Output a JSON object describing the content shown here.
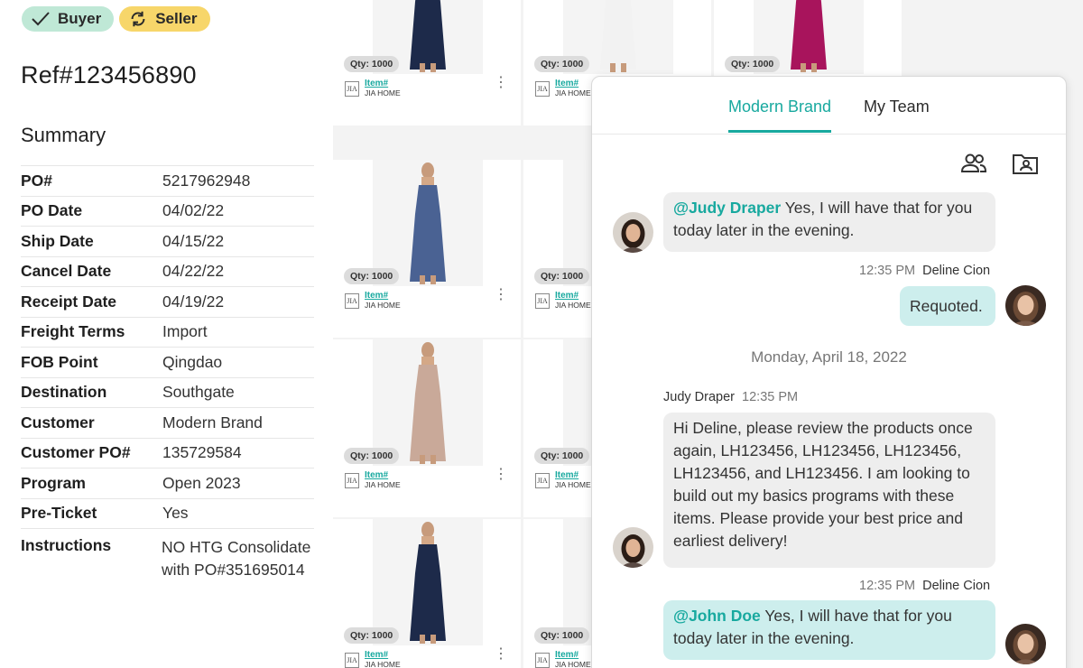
{
  "roles": {
    "buyer": "Buyer",
    "seller": "Seller"
  },
  "ref": "Ref#123456890",
  "summary": {
    "title": "Summary",
    "rows": [
      {
        "key": "PO#",
        "value": "5217962948"
      },
      {
        "key": "PO Date",
        "value": "04/02/22"
      },
      {
        "key": "Ship Date",
        "value": "04/15/22"
      },
      {
        "key": "Cancel Date",
        "value": "04/22/22"
      },
      {
        "key": "Receipt Date",
        "value": "04/19/22"
      },
      {
        "key": "Freight Terms",
        "value": "Import"
      },
      {
        "key": "FOB Point",
        "value": "Qingdao"
      },
      {
        "key": "Destination",
        "value": "Southgate"
      },
      {
        "key": "Customer",
        "value": "Modern Brand"
      },
      {
        "key": "Customer PO#",
        "value": "135729584"
      },
      {
        "key": "Program",
        "value": "Open 2023"
      },
      {
        "key": "Pre-Ticket",
        "value": "Yes"
      },
      {
        "key": "Instructions",
        "value": "NO HTG Consolidate with PO#351695014"
      }
    ]
  },
  "products": {
    "qty_label": "Qty: 1000",
    "item_label": "Item#",
    "brand_name": "JIA HOME",
    "brand_logo": "JIA",
    "tiles": [
      {
        "dress_color": "#1d2a4a"
      },
      {
        "dress_color": "#f2f2f2"
      },
      {
        "dress_color": "#a8145c"
      },
      {
        "dress_color": "#4a6293"
      },
      {
        "dress_color": "#3e3e3e"
      },
      {
        "dress_color": "#2f6b5a"
      },
      {
        "dress_color": "#c9a999"
      },
      {
        "dress_color": "#1d2a4a"
      },
      {
        "dress_color": "#dddddd"
      }
    ]
  },
  "chat": {
    "tabs": [
      "Modern Brand",
      "My Team"
    ],
    "icons": [
      "people-icon",
      "folder-contact-icon"
    ],
    "messages": {
      "m1_mention": "@Judy Draper",
      "m1_text": " Yes, I will have that for you today later in the evening.",
      "m2_time": "12:35 PM",
      "m2_author": "Deline Cion",
      "m2_text": "Requoted.",
      "date": "Monday, April 18, 2022",
      "m3_author": "Judy Draper",
      "m3_time": "12:35 PM",
      "m3_text": "Hi Deline, please review the products once again, LH123456, LH123456, LH123456, LH123456, and LH123456. I am looking to build out my basics programs with these items. Please provide your best price and earliest delivery!",
      "m4_time": "12:35 PM",
      "m4_author": "Deline Cion",
      "m4_mention": "@John Doe",
      "m4_text": " Yes, I will have that for you today later in the evening."
    }
  },
  "colors": {
    "accent": "#18a99f",
    "buyer_pill": "#bfe8d6",
    "seller_pill": "#f7d66a"
  }
}
